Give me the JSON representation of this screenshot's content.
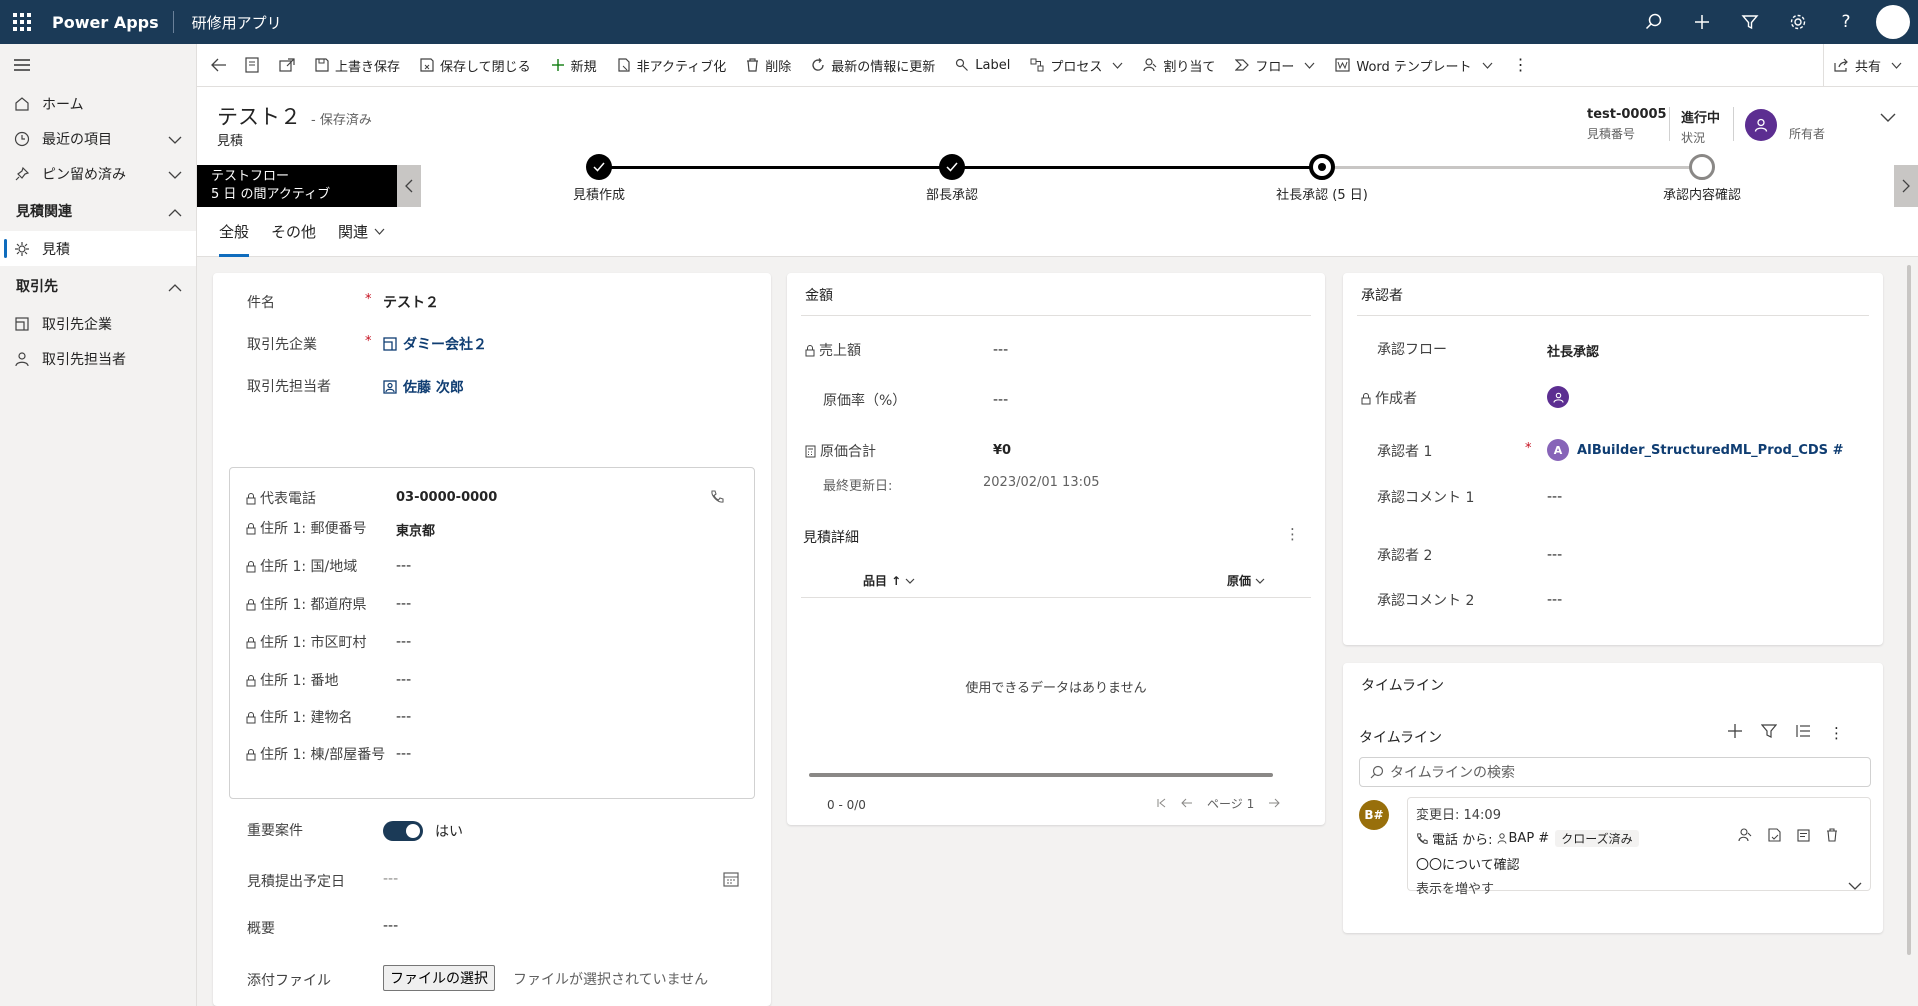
{
  "topbar": {
    "brand": "Power Apps",
    "app_name": "研修用アプリ"
  },
  "nav": {
    "home": "ホーム",
    "recent": "最近の項目",
    "pinned": "ピン留め済み",
    "group1": "見積関連",
    "quote": "見積",
    "group2": "取引先",
    "accounts": "取引先企業",
    "contacts": "取引先担当者"
  },
  "cmdbar": {
    "save": "上書き保存",
    "save_close": "保存して閉じる",
    "new": "新規",
    "deactivate": "非アクティブ化",
    "delete": "削除",
    "refresh": "最新の情報に更新",
    "label": "Label",
    "process": "プロセス",
    "assign": "割り当て",
    "flow": "フロー",
    "word": "Word テンプレート",
    "share": "共有"
  },
  "record": {
    "title": "テスト２",
    "saved": "- 保存済み",
    "entity": "見積",
    "number_value": "test-00005",
    "number_label": "見積番号",
    "status_value": "進行中",
    "status_label": "状況",
    "owner_label": "所有者"
  },
  "bpf": {
    "flow_name": "テストフロー",
    "flow_status": "5 日 の間アクティブ",
    "stages": [
      "見積作成",
      "部長承認",
      "社長承認 (5 日)",
      "承認内容確認"
    ]
  },
  "tabs": [
    "全般",
    "その他",
    "関連"
  ],
  "general": {
    "subject_label": "件名",
    "subject_value": "テスト２",
    "account_label": "取引先企業",
    "account_value": "ダミー会社２",
    "contact_label": "取引先担当者",
    "contact_value": "佐藤 次郎",
    "phone_label": "代表電話",
    "phone_value": "03-0000-0000",
    "postal_label": "住所 1: 郵便番号",
    "postal_value": "東京都",
    "country_label": "住所 1: 国/地域",
    "country_value": "---",
    "pref_label": "住所 1: 都道府県",
    "pref_value": "---",
    "city_label": "住所 1: 市区町村",
    "city_value": "---",
    "street_label": "住所 1: 番地",
    "street_value": "---",
    "building_label": "住所 1: 建物名",
    "building_value": "---",
    "room_label": "住所 1: 棟/部屋番号",
    "room_value": "---",
    "important_label": "重要案件",
    "important_value": "はい",
    "duedate_label": "見積提出予定日",
    "duedate_value": "---",
    "summary_label": "概要",
    "summary_value": "---",
    "attach_label": "添付ファイル",
    "attach_button": "ファイルの選択",
    "attach_status": "ファイルが選択されていません"
  },
  "amount": {
    "title": "金額",
    "sales_label": "売上額",
    "sales_value": "---",
    "ratio_label": "原価率（%）",
    "ratio_value": "---",
    "cost_label": "原価合計",
    "cost_value": "¥0",
    "updated_label": "最終更新日:",
    "updated_value": "2023/02/01 13:05",
    "detail_title": "見積詳細",
    "col_item": "品目 ↑",
    "col_cost": "原価",
    "empty": "使用できるデータはありません",
    "paging_count": "0 - 0/0",
    "paging_page": "ページ 1"
  },
  "approver": {
    "title": "承認者",
    "flow_label": "承認フロー",
    "flow_value": "社長承認",
    "creator_label": "作成者",
    "approver1_label": "承認者 1",
    "approver1_value": "AIBuilder_StructuredML_Prod_CDS #",
    "approver1_initial": "A",
    "comment1_label": "承認コメント 1",
    "comment1_value": "---",
    "approver2_label": "承認者 2",
    "approver2_value": "---",
    "comment2_label": "承認コメント 2",
    "comment2_value": "---"
  },
  "timeline": {
    "section_title": "タイムライン",
    "title": "タイムライン",
    "search_placeholder": "タイムラインの検索",
    "post_avatar": "B#",
    "post_modified": "変更日: 14:09",
    "post_from": "電話 から:",
    "post_user": "BAP #",
    "post_status": "クローズ済み",
    "post_body": "〇〇について確認",
    "show_more": "表示を増やす"
  }
}
